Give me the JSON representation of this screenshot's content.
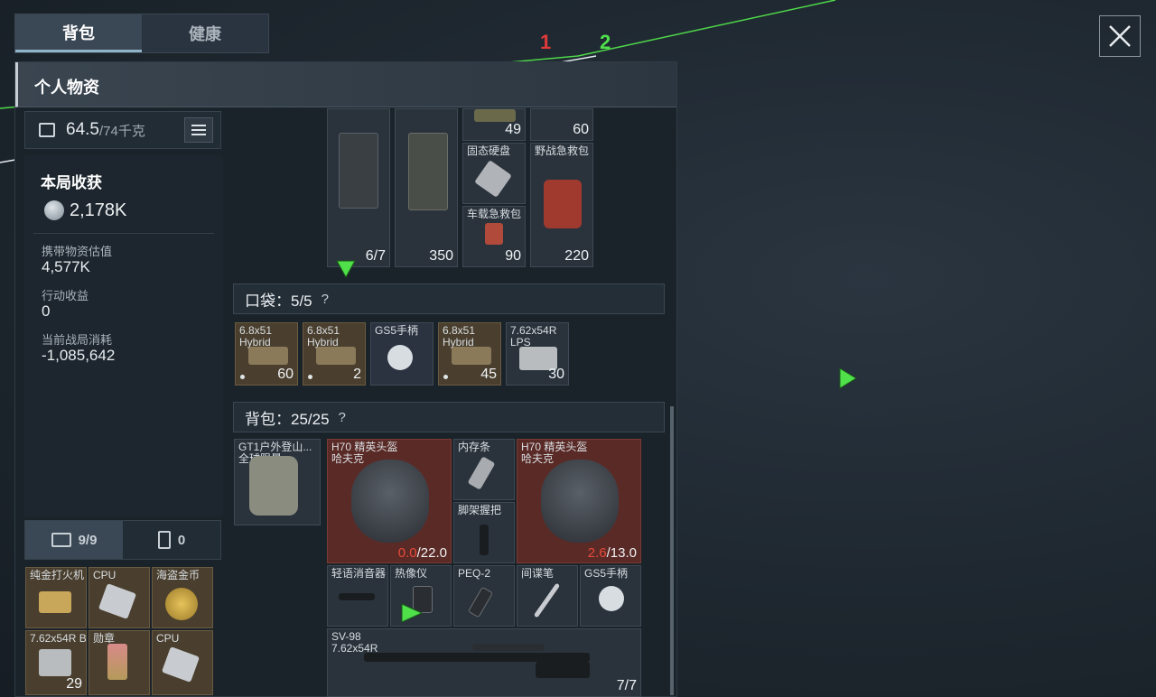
{
  "tabs": {
    "backpack": "背包",
    "health": "健康"
  },
  "panel_title": "个人物资",
  "weight": {
    "value": "64.5",
    "max": "/74千克"
  },
  "harvest": {
    "title": "本局收获",
    "value": "2,178K",
    "stats": [
      {
        "label": "携带物资估值",
        "value": "4,577K"
      },
      {
        "label": "行动收益",
        "value": "0"
      },
      {
        "label": "当前战局消耗",
        "value": "-1,085,642"
      }
    ]
  },
  "side_tabs": {
    "case_count": "9/9",
    "other_count": "0"
  },
  "secure_items": [
    {
      "name": "纯金打火机",
      "count": ""
    },
    {
      "name": "CPU",
      "count": ""
    },
    {
      "name": "海盗金币",
      "count": ""
    },
    {
      "name": "7.62x54R B",
      "count": "29"
    },
    {
      "name": "勋章",
      "count": ""
    },
    {
      "name": "CPU",
      "count": ""
    }
  ],
  "top_items": [
    {
      "name": "",
      "count": "6/7"
    },
    {
      "name": "",
      "count": "350"
    },
    {
      "name": "",
      "count": "49"
    },
    {
      "name": "",
      "count": "60"
    },
    {
      "name": "固态硬盘",
      "count": ""
    },
    {
      "name": "野战急救包",
      "count": "220"
    },
    {
      "name": "车载急救包",
      "count": "90"
    }
  ],
  "pocket": {
    "label": "口袋：5/5",
    "help": "?",
    "items": [
      {
        "name": "6.8x51 Hybrid",
        "count": "60"
      },
      {
        "name": "6.8x51 Hybrid",
        "count": "2"
      },
      {
        "name": "GS5手柄",
        "count": ""
      },
      {
        "name": "6.8x51 Hybrid",
        "count": "45"
      },
      {
        "name": "7.62x54R LPS",
        "count": "30"
      }
    ]
  },
  "backpack": {
    "label": "背包：25/25",
    "help": "?",
    "items": [
      {
        "name": "GT1户外登山... 全球限量",
        "count": ""
      },
      {
        "name": "H70 精英头盔 哈夫克",
        "dur": "0.0",
        "max": "/22.0"
      },
      {
        "name": "内存条",
        "count": ""
      },
      {
        "name": "脚架握把",
        "count": ""
      },
      {
        "name": "H70 精英头盔 哈夫克",
        "dur": "2.6",
        "max": "/13.0"
      },
      {
        "name": "轻语消音器",
        "count": ""
      },
      {
        "name": "热像仪",
        "count": ""
      },
      {
        "name": "PEQ-2",
        "count": ""
      },
      {
        "name": "间谍笔",
        "count": ""
      },
      {
        "name": "GS5手柄",
        "count": ""
      },
      {
        "name": "SV-98 7.62x54R",
        "count": "7/7"
      }
    ]
  },
  "markers": {
    "red": "1",
    "green": "2"
  },
  "colors": {
    "accent_green": "#4fe04a",
    "alert_red": "#e03a3a",
    "durability_red": "#e84a3a"
  }
}
